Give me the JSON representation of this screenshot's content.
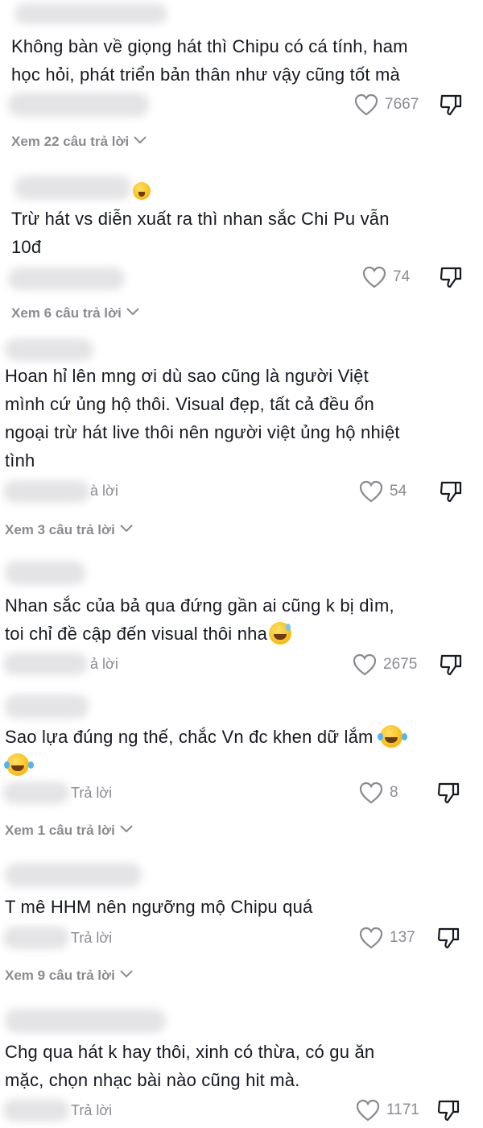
{
  "ui": {
    "reply_label": "Trả lời",
    "reply_label_cut": "ả lời",
    "reply_label_cut2": "à lời"
  },
  "comments": [
    {
      "text": "Không bàn về giọng hát thì Chipu có cá tính, ham\nhọc hỏi, phát triển bản thân như vậy cũng tốt mà",
      "likes": "7667",
      "view_replies": "Xem 22 câu trả lời"
    },
    {
      "text": "Trừ hát vs diễn xuất ra thì nhan sắc Chi Pu vẫn\n10đ",
      "likes": "74",
      "view_replies": "Xem 6 câu trả lời"
    },
    {
      "text": "Hoan hỉ lên mng ơi dù sao cũng là người Việt\nmình cứ ủng hộ thôi. Visual đẹp, tất cả đều ổn\nngoại trừ hát live thôi nên người việt ủng hộ nhiệt\ntình",
      "likes": "54",
      "view_replies": "Xem 3 câu trả lời"
    },
    {
      "text": "Nhan sắc của bả qua đứng gần ai cũng k bị dìm,\ntoi chỉ đề cập đến visual thôi nha",
      "likes": "2675"
    },
    {
      "text": "Sao lựa đúng ng thế, chắc Vn đc khen dữ lắm ",
      "likes": "8",
      "view_replies": "Xem 1 câu trả lời"
    },
    {
      "text": "T mê HHM nên ngưỡng mộ Chipu quá",
      "likes": "137",
      "view_replies": "Xem 9 câu trả lời"
    },
    {
      "text": "Chg qua hát k hay thôi, xinh có thừa, có gu ăn\nmặc, chọn nhạc bài nào cũng hit mà.",
      "likes": "1171"
    }
  ],
  "icons": {
    "heart": "heart-outline-icon",
    "dislike": "thumbs-down-icon",
    "chevron": "chevron-down-icon",
    "emoji_tear": "face-with-tears-of-joy-icon",
    "emoji_sweat": "grinning-face-with-sweat-icon",
    "emoji_kiss": "kissing-face-icon"
  }
}
